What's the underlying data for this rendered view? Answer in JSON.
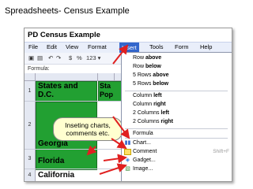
{
  "slide": {
    "title": "Spreadsheets-  Census Example"
  },
  "doc": {
    "title": "PD Census Example"
  },
  "menu": [
    {
      "label": "File"
    },
    {
      "label": "Edit"
    },
    {
      "label": "View"
    },
    {
      "label": "Format"
    },
    {
      "label": "Insert"
    },
    {
      "label": "Tools"
    },
    {
      "label": "Form"
    },
    {
      "label": "Help"
    }
  ],
  "toolbar": {
    "percent": "%",
    "dollar": "$",
    "number_format": "123 ▾"
  },
  "formula": {
    "label": "Formula:"
  },
  "rows": [
    {
      "num": "1",
      "text": "States and D.C."
    },
    {
      "num": "2",
      "text": "Georgia"
    },
    {
      "num": "3",
      "text": "Florida"
    },
    {
      "num": "4",
      "text": "California"
    }
  ],
  "row1_col2": "Sta Pop",
  "callout": {
    "text": "Inseting charts, comments etc."
  },
  "insert_menu": {
    "row_above": {
      "pre": "Row ",
      "bold": "above"
    },
    "row_below": {
      "pre": "Row ",
      "bold": "below"
    },
    "rows_above": {
      "pre": "5 Rows ",
      "bold": "above"
    },
    "rows_below": {
      "pre": "5 Rows ",
      "bold": "below"
    },
    "col_left": {
      "pre": "Column ",
      "bold": "left"
    },
    "col_right": {
      "pre": "Column ",
      "bold": "right"
    },
    "cols_left": {
      "pre": "2 Columns ",
      "bold": "left"
    },
    "cols_right": {
      "pre": "2 Columns ",
      "bold": "right"
    },
    "formula": "Formula",
    "chart": "Chart...",
    "comment": "Comment",
    "comment_shortcut": "Shift+F",
    "gadget": "Gadget...",
    "image": "Image..."
  },
  "colors": {
    "accent": "#3366cc",
    "green_cell": "#22a032",
    "arrow": "#e02020"
  }
}
